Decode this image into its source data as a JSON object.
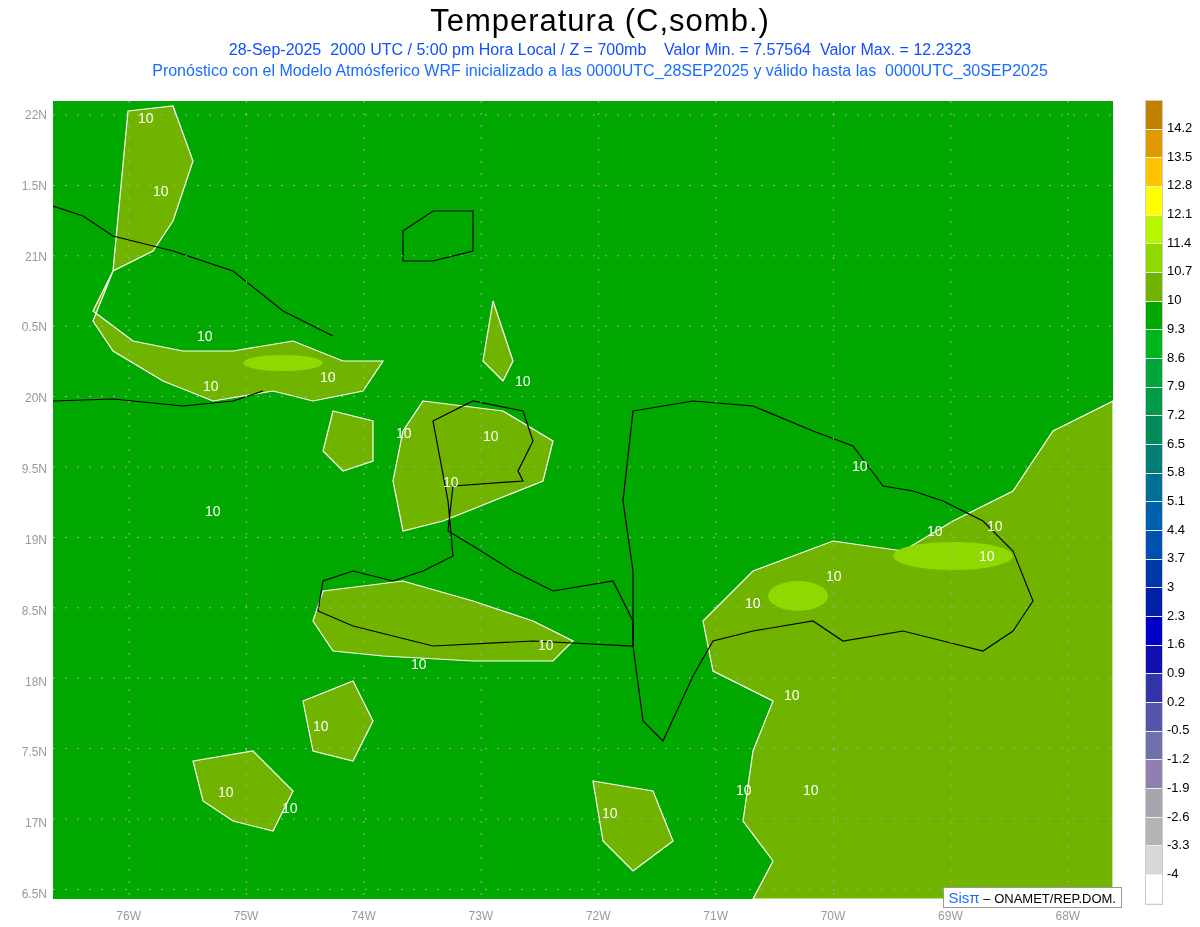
{
  "title": "Temperatura (C,somb.)",
  "subtitle_lines": [
    "28-Sep-2025  2000 UTC / 5:00 pm Hora Local / Z = 700mb    Valor Min. = 7.57564  Valor Max. = 12.2323",
    "Pronóstico con el Modelo Atmósferico WRF inicializado a las 0000UTC_28SEP2025 y válido hasta las  0000UTC_30SEP2025"
  ],
  "lat_labels": [
    "22N",
    "1.5N",
    "21N",
    "0.5N",
    "20N",
    "9.5N",
    "19N",
    "8.5N",
    "18N",
    "7.5N",
    "17N",
    "6.5N"
  ],
  "lon_labels": [
    "76W",
    "75W",
    "74W",
    "73W",
    "72W",
    "71W",
    "70W",
    "69W",
    "68W"
  ],
  "contour_labels": [
    "10",
    "10",
    "10",
    "10",
    "10",
    "10",
    "10",
    "10",
    "10",
    "10",
    "10",
    "10",
    "10",
    "10",
    "10",
    "10",
    "10",
    "10",
    "10",
    "10",
    "10",
    "10",
    "10",
    "10",
    "10"
  ],
  "credit": {
    "brand": "Sisπ",
    "text": "– ONAMET/REP.DOM."
  },
  "colorbar": {
    "bins": [
      {
        "color": "#c08000"
      },
      {
        "color": "#e09a00"
      },
      {
        "color": "#ffc400"
      },
      {
        "color": "#ffff00"
      },
      {
        "color": "#b8f500"
      },
      {
        "color": "#8fd800"
      },
      {
        "color": "#70b400"
      },
      {
        "color": "#00a800"
      },
      {
        "color": "#00b41e"
      },
      {
        "color": "#00a63a"
      },
      {
        "color": "#009a48"
      },
      {
        "color": "#008c5a"
      },
      {
        "color": "#007e72"
      },
      {
        "color": "#006f94"
      },
      {
        "color": "#0060b0"
      },
      {
        "color": "#0050b0"
      },
      {
        "color": "#0038a8"
      },
      {
        "color": "#0020a8"
      },
      {
        "color": "#0000c8"
      },
      {
        "color": "#1010b0"
      },
      {
        "color": "#3333aa"
      },
      {
        "color": "#5555aa"
      },
      {
        "color": "#7070aa"
      },
      {
        "color": "#9080b0"
      },
      {
        "color": "#a6a6b0"
      },
      {
        "color": "#b4b4b4"
      },
      {
        "color": "#d8d8d8"
      },
      {
        "color": "#ffffff"
      }
    ],
    "labels": [
      "14.2",
      "13.5",
      "12.8",
      "12.1",
      "11.4",
      "10.7",
      "10",
      "9.3",
      "8.6",
      "7.9",
      "7.2",
      "6.5",
      "5.8",
      "5.1",
      "4.4",
      "3.7",
      "3",
      "2.3",
      "1.6",
      "0.9",
      "0.2",
      "-0.5",
      "-1.2",
      "-1.9",
      "-2.6",
      "-3.3",
      "-4"
    ]
  }
}
